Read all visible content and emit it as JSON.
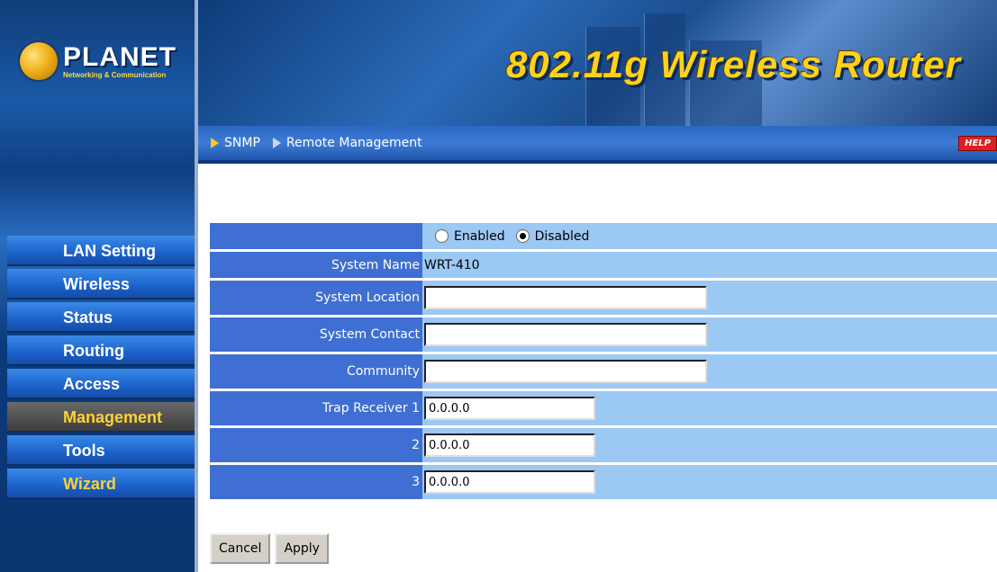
{
  "logo": {
    "brand": "PLANET",
    "tagline": "Networking & Communication"
  },
  "header": {
    "title": "802.11g Wireless Router"
  },
  "breadcrumb": {
    "section": "SNMP",
    "page": "Remote Management",
    "help_label": "HELP"
  },
  "sidebar": {
    "items": [
      {
        "label": "LAN Setting"
      },
      {
        "label": "Wireless"
      },
      {
        "label": "Status"
      },
      {
        "label": "Routing"
      },
      {
        "label": "Access"
      },
      {
        "label": "Management"
      },
      {
        "label": "Tools"
      },
      {
        "label": "Wizard"
      }
    ],
    "active": "Management"
  },
  "form": {
    "snmp_enabled_label": "Enabled",
    "snmp_disabled_label": "Disabled",
    "snmp_selected": "Disabled",
    "system_name_label": "System Name",
    "system_name_value": "WRT-410",
    "system_location_label": "System Location",
    "system_location_value": "",
    "system_contact_label": "System Contact",
    "system_contact_value": "",
    "community_label": "Community",
    "community_value": "",
    "trap1_label": "Trap Receiver 1",
    "trap1_value": "0.0.0.0",
    "trap2_label": "2",
    "trap2_value": "0.0.0.0",
    "trap3_label": "3",
    "trap3_value": "0.0.0.0"
  },
  "buttons": {
    "cancel": "Cancel",
    "apply": "Apply"
  },
  "colors": {
    "label_bg": "#3f6fd2",
    "value_bg": "#9cc8f4",
    "title_yellow": "#ffd21a",
    "active_menu": "#3a3a3a"
  }
}
